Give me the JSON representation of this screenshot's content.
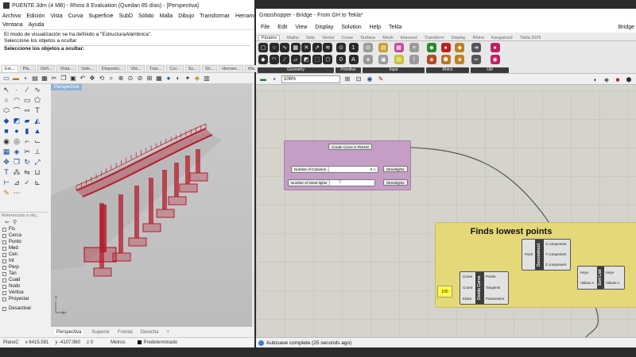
{
  "rhino": {
    "title": "PUENTE.3dm (4 MB) - Rhino 8 Evaluation (Quedan 85 días) - [Perspectiva]",
    "menu": [
      "Archivo",
      "Edición",
      "Vista",
      "Curva",
      "Superficie",
      "SubD",
      "Sólido",
      "Malla",
      "Dibujo",
      "Transformar",
      "Herramientas",
      "Ventana",
      "Ayuda"
    ],
    "command_lines": [
      "El modo de visualización se ha definido a \"EstructuraAlámbrica\".",
      "Seleccione los objetos a ocultar"
    ],
    "prompt": "Seleccione los objetos a ocultar:",
    "toolbar_tabs": [
      "Est...",
      "Pla...",
      "Defi...",
      "Vista...",
      "Sele...",
      "Disposici...",
      "Visi...",
      "Tran...",
      "Cur...",
      "Su...",
      "Só...",
      "Herram...",
      "Ma..."
    ],
    "viewport_label": "Perspectiva",
    "viewport_tabs": [
      "Perspectiva",
      "Superior",
      "Frontal",
      "Derecha"
    ],
    "viewport_add": "+",
    "layers_header": "Referencias a obj...",
    "layers": [
      "Fis",
      "Cerca",
      "Punto",
      "Med",
      "Cen",
      "Int",
      "Perp",
      "Tan",
      "Cuad",
      "Nodo",
      "Vértice",
      "Proyectar",
      "Desactivar"
    ],
    "status": {
      "plane": "PlanoC",
      "x": "x 6415.581",
      "y": "y -4107.960",
      "z": "z 0",
      "units": "Metros",
      "layer": "Predeterminado"
    },
    "axis_label_y": "y",
    "axis_label_x": "x",
    "model_color": "#b41e2e"
  },
  "gh": {
    "title": "Grasshopper - Bridge - From GH to Tekla*",
    "menu": [
      "File",
      "Edit",
      "View",
      "Display",
      "Solution",
      "Help",
      "Tekla"
    ],
    "doc_name": "Bridge",
    "tabs": [
      "Params",
      "Maths",
      "Sets",
      "Vector",
      "Curve",
      "Surface",
      "Mesh",
      "Intersect",
      "Transform",
      "Display",
      "Rhino",
      "Kangaroo2",
      "Tekla 2025"
    ],
    "ribbon_groups": [
      "Geometry",
      "Primitive",
      "Input",
      "Rhino",
      "Util"
    ],
    "zoom": "106%",
    "canvas": {
      "create_curve": "Create Curve in RHINO",
      "slider1_label": "Number of Columns",
      "slider1_value": "8",
      "slider1_diamond": "◇",
      "slider2_label": "Number of street lights",
      "streetlights_1": "Streetlights",
      "streetlights_2": "Streetlights",
      "group_title": "Finds lowest points",
      "panel_value": "100",
      "decon_title": "Deconstruct",
      "decon_in": "Point",
      "decon_out": [
        "X component",
        "Y component",
        "Z component"
      ],
      "divide_title": "Divide Curve",
      "divide_in": [
        "Curve",
        "Count",
        "Kinks"
      ],
      "divide_out": [
        "Points",
        "Tangents",
        "Parameters"
      ],
      "sort_title": "Sort List",
      "sort_in": [
        "Keys",
        "Values A"
      ],
      "sort_out": [
        "Keys",
        "Values A"
      ]
    },
    "status": "Autosave complete (25 seconds ago)",
    "group_pink": "#c59ec5",
    "group_yellow": "#e4d878"
  }
}
